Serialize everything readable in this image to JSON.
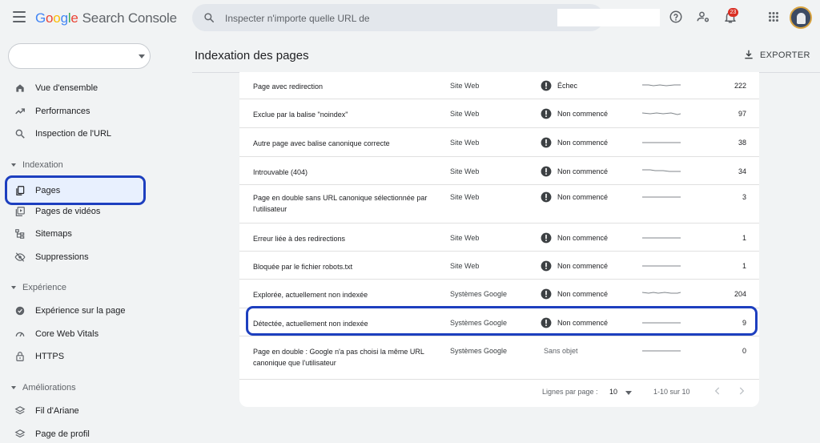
{
  "app": {
    "logo_parts": [
      "G",
      "o",
      "o",
      "g",
      "l",
      "e"
    ],
    "product": "Search Console"
  },
  "search": {
    "placeholder": "Inspecter n'importe quelle URL de"
  },
  "notifications": {
    "count": "23"
  },
  "page": {
    "title": "Indexation des pages",
    "export_label": "EXPORTER"
  },
  "sidebar": {
    "items_top": [
      {
        "label": "Vue d'ensemble",
        "icon": "home-icon"
      },
      {
        "label": "Performances",
        "icon": "trending-up-icon"
      },
      {
        "label": "Inspection de l'URL",
        "icon": "search-icon"
      }
    ],
    "section_indexation": "Indexation",
    "items_indexation": [
      {
        "label": "Pages",
        "icon": "pages-icon"
      },
      {
        "label": "Pages de vidéos",
        "icon": "video-pages-icon"
      },
      {
        "label": "Sitemaps",
        "icon": "sitemap-icon"
      },
      {
        "label": "Suppressions",
        "icon": "visibility-off-icon"
      }
    ],
    "section_experience": "Expérience",
    "items_experience": [
      {
        "label": "Expérience sur la page",
        "icon": "page-experience-icon"
      },
      {
        "label": "Core Web Vitals",
        "icon": "speed-icon"
      },
      {
        "label": "HTTPS",
        "icon": "lock-icon"
      }
    ],
    "section_ameliorations": "Améliorations",
    "items_ameliorations": [
      {
        "label": "Fil d'Ariane",
        "icon": "layers-icon"
      },
      {
        "label": "Page de profil",
        "icon": "layers-icon"
      }
    ]
  },
  "table": {
    "rows": [
      {
        "reason": "Page avec redirection",
        "source": "Site Web",
        "status": "Échec",
        "count": "222"
      },
      {
        "reason": "Exclue par la balise \"noindex\"",
        "source": "Site Web",
        "status": "Non commencé",
        "count": "97"
      },
      {
        "reason": "Autre page avec balise canonique correcte",
        "source": "Site Web",
        "status": "Non commencé",
        "count": "38"
      },
      {
        "reason": "Introuvable (404)",
        "source": "Site Web",
        "status": "Non commencé",
        "count": "34"
      },
      {
        "reason": "Page en double sans URL canonique sélectionnée par l'utilisateur",
        "source": "Site Web",
        "status": "Non commencé",
        "count": "3"
      },
      {
        "reason": "Erreur liée à des redirections",
        "source": "Site Web",
        "status": "Non commencé",
        "count": "1"
      },
      {
        "reason": "Bloquée par le fichier robots.txt",
        "source": "Site Web",
        "status": "Non commencé",
        "count": "1"
      },
      {
        "reason": "Explorée, actuellement non indexée",
        "source": "Systèmes Google",
        "status": "Non commencé",
        "count": "204"
      },
      {
        "reason": "Détectée, actuellement non indexée",
        "source": "Systèmes Google",
        "status": "Non commencé",
        "count": "9"
      },
      {
        "reason": "Page en double : Google n'a pas choisi la même URL canonique que l'utilisateur",
        "source": "Systèmes Google",
        "status": "Sans objet",
        "count": "0"
      }
    ],
    "pagination": {
      "rows_label": "Lignes par page :",
      "rows_value": "10",
      "range": "1-10 sur 10"
    }
  },
  "colors": {
    "accent": "#1a73e8",
    "highlight_outline": "#1d3fbf",
    "status_icon": "#3c4043",
    "badge": "#d93025"
  }
}
